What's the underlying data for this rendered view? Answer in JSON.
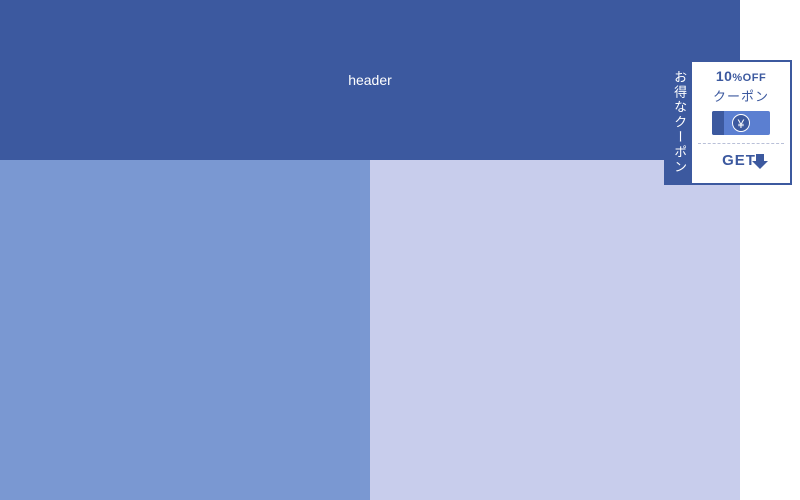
{
  "header": {
    "label": "header"
  },
  "coupon": {
    "tab_label": "お得なクーポン",
    "discount_number": "10",
    "discount_suffix": "%OFF",
    "subtitle": "クーポン",
    "yen_symbol": "¥",
    "get_label": "GET"
  }
}
